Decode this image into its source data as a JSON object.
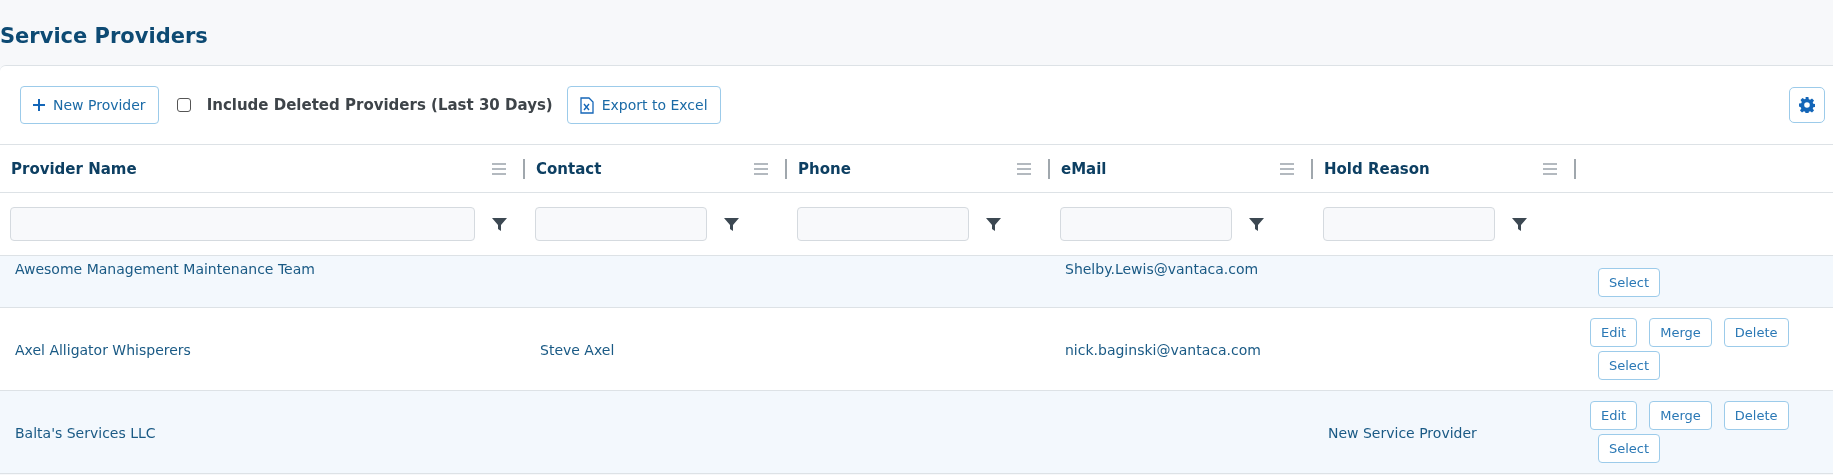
{
  "page_title": "Service Providers",
  "toolbar": {
    "new_button": "New Provider",
    "include_deleted": {
      "label": "Include Deleted Providers (Last 30 Days)",
      "checked": false
    },
    "export_button": "Export to Excel"
  },
  "table": {
    "columns": [
      {
        "label": "Provider Name"
      },
      {
        "label": "Contact"
      },
      {
        "label": "Phone"
      },
      {
        "label": "eMail"
      },
      {
        "label": "Hold Reason"
      }
    ],
    "rows": [
      {
        "cells": [
          "Awesome Management Maintenance Team",
          "",
          "",
          "Shelby.Lewis@vantaca.com",
          ""
        ],
        "actions": [
          "Select"
        ],
        "scrolled": true
      },
      {
        "cells": [
          "Axel Alligator Whisperers",
          "Steve Axel",
          "",
          "nick.baginski@vantaca.com",
          ""
        ],
        "actions": [
          "Edit",
          "Merge",
          "Delete",
          "Select"
        ],
        "scrolled": false
      },
      {
        "cells": [
          "Balta's Services LLC",
          "",
          "",
          "",
          "New Service Provider"
        ],
        "actions": [
          "Edit",
          "Merge",
          "Delete",
          "Select"
        ],
        "scrolled": false
      }
    ]
  }
}
